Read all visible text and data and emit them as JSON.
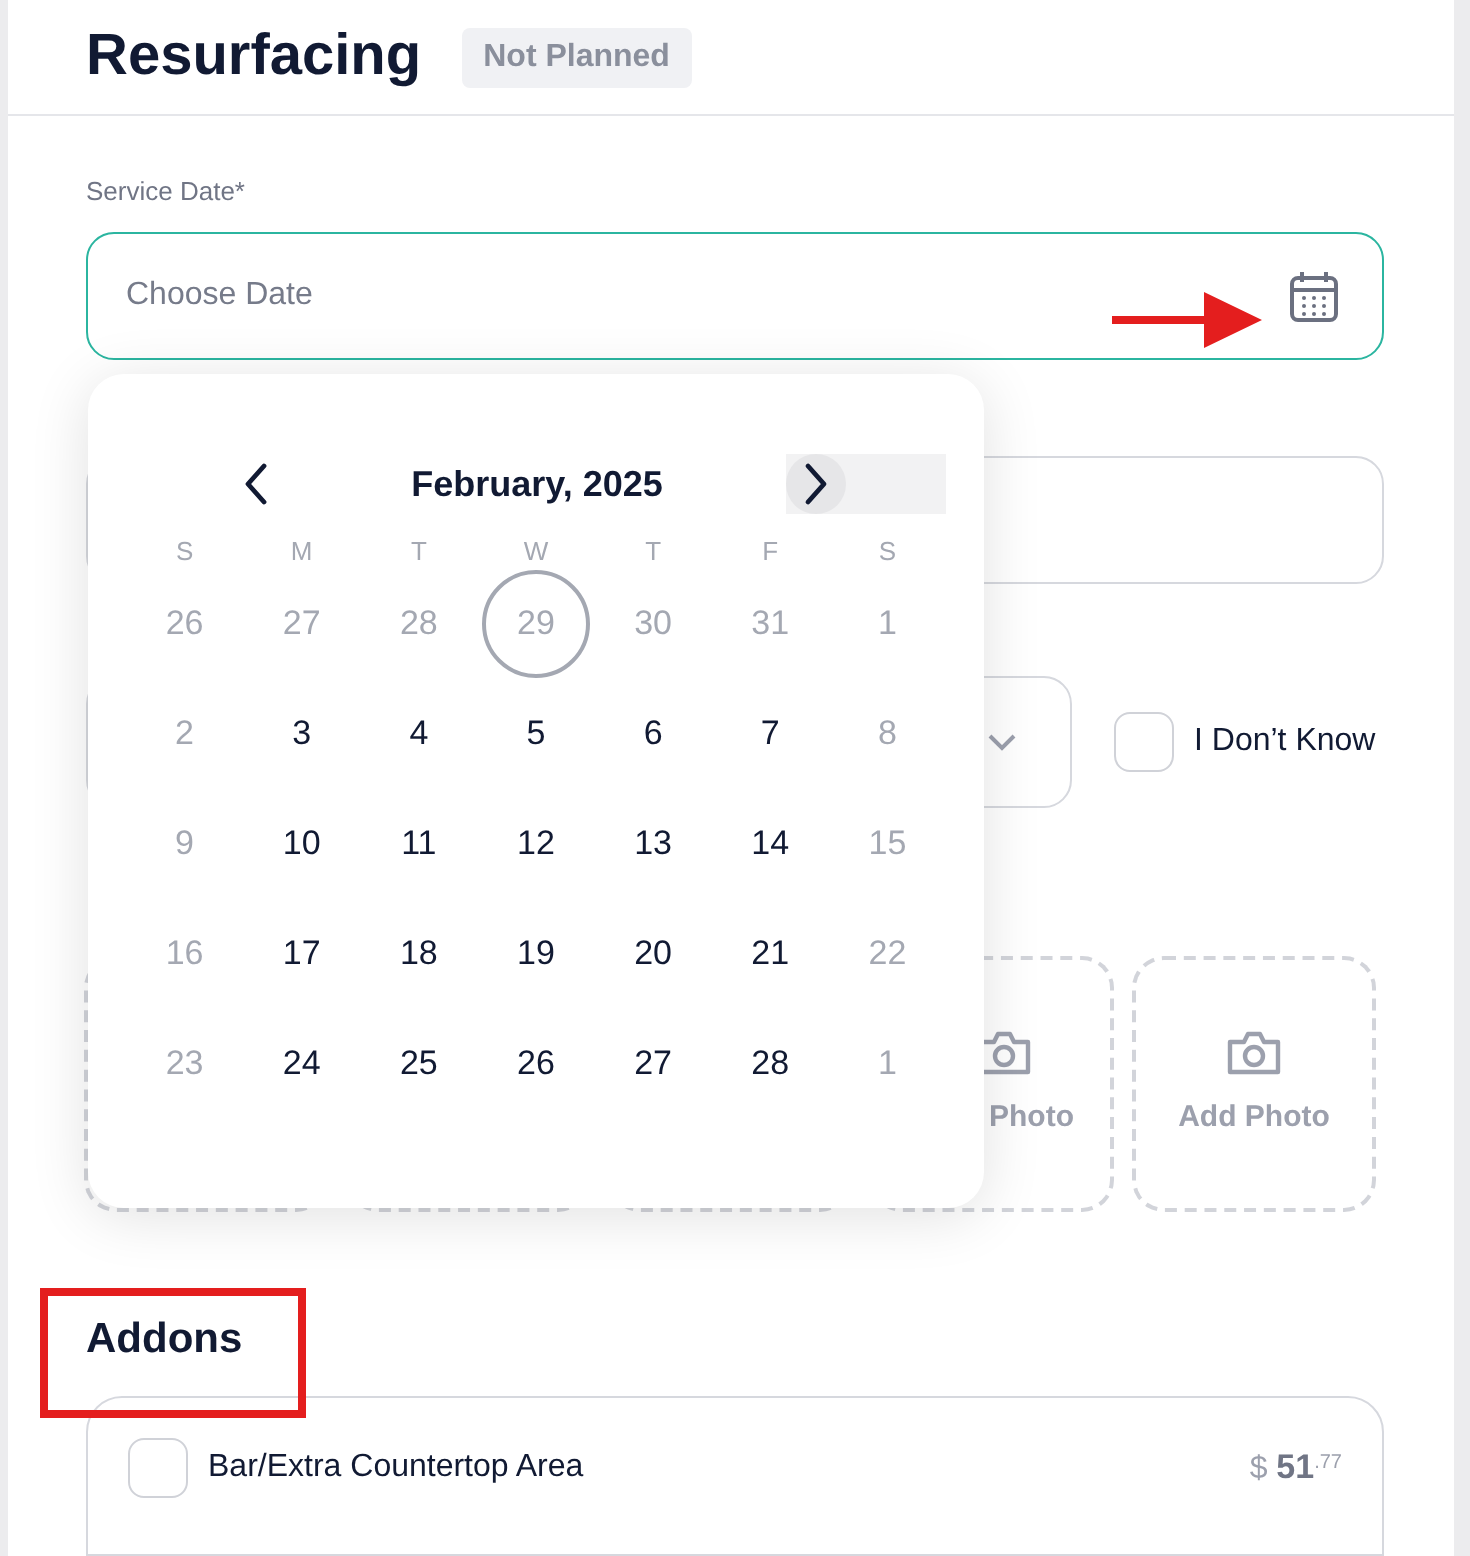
{
  "header": {
    "title": "Resurfacing",
    "status": "Not Planned"
  },
  "service_date": {
    "label": "Service Date*",
    "placeholder": "Choose Date",
    "focused": true
  },
  "calendar": {
    "month": "February, 2025",
    "weekdays": [
      "S",
      "M",
      "T",
      "W",
      "T",
      "F",
      "S"
    ],
    "weeks": [
      [
        {
          "label": "26",
          "muted": true,
          "ring": false
        },
        {
          "label": "27",
          "muted": true,
          "ring": false
        },
        {
          "label": "28",
          "muted": true,
          "ring": false
        },
        {
          "label": "29",
          "muted": true,
          "ring": true
        },
        {
          "label": "30",
          "muted": true,
          "ring": false
        },
        {
          "label": "31",
          "muted": true,
          "ring": false
        },
        {
          "label": "1",
          "muted": true,
          "ring": false
        }
      ],
      [
        {
          "label": "2",
          "muted": true,
          "ring": false
        },
        {
          "label": "3",
          "muted": false,
          "ring": false
        },
        {
          "label": "4",
          "muted": false,
          "ring": false
        },
        {
          "label": "5",
          "muted": false,
          "ring": false
        },
        {
          "label": "6",
          "muted": false,
          "ring": false
        },
        {
          "label": "7",
          "muted": false,
          "ring": false
        },
        {
          "label": "8",
          "muted": true,
          "ring": false
        }
      ],
      [
        {
          "label": "9",
          "muted": true,
          "ring": false
        },
        {
          "label": "10",
          "muted": false,
          "ring": false
        },
        {
          "label": "11",
          "muted": false,
          "ring": false
        },
        {
          "label": "12",
          "muted": false,
          "ring": false
        },
        {
          "label": "13",
          "muted": false,
          "ring": false
        },
        {
          "label": "14",
          "muted": false,
          "ring": false
        },
        {
          "label": "15",
          "muted": true,
          "ring": false
        }
      ],
      [
        {
          "label": "16",
          "muted": true,
          "ring": false
        },
        {
          "label": "17",
          "muted": false,
          "ring": false
        },
        {
          "label": "18",
          "muted": false,
          "ring": false
        },
        {
          "label": "19",
          "muted": false,
          "ring": false
        },
        {
          "label": "20",
          "muted": false,
          "ring": false
        },
        {
          "label": "21",
          "muted": false,
          "ring": false
        },
        {
          "label": "22",
          "muted": true,
          "ring": false
        }
      ],
      [
        {
          "label": "23",
          "muted": true,
          "ring": false
        },
        {
          "label": "24",
          "muted": false,
          "ring": false
        },
        {
          "label": "25",
          "muted": false,
          "ring": false
        },
        {
          "label": "26",
          "muted": false,
          "ring": false
        },
        {
          "label": "27",
          "muted": false,
          "ring": false
        },
        {
          "label": "28",
          "muted": false,
          "ring": false
        },
        {
          "label": "1",
          "muted": true,
          "ring": false
        }
      ]
    ]
  },
  "dont_know": {
    "label": "I Don’t Know",
    "checked": false
  },
  "photo_tiles": [
    {
      "kind": "empty"
    },
    {
      "kind": "empty"
    },
    {
      "kind": "empty"
    },
    {
      "kind": "partial",
      "label": "Photo"
    },
    {
      "kind": "add",
      "label": "Add Photo"
    }
  ],
  "addons": {
    "title": "Addons",
    "items": [
      {
        "name": "Bar/Extra Countertop Area",
        "checked": false,
        "currency": "$",
        "amount": "51",
        "cents": ".77"
      }
    ]
  }
}
